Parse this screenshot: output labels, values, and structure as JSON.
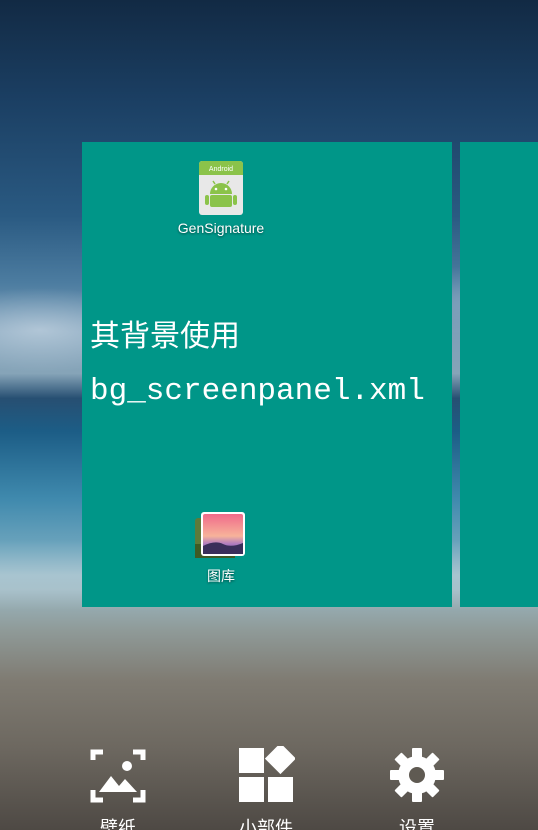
{
  "home": {
    "apps": [
      {
        "label": "GenSignature",
        "icon": "android-app-icon"
      },
      {
        "label": "图库",
        "icon": "gallery-icon"
      }
    ],
    "caption_line1": "其背景使用",
    "caption_line2": "bg_screenpanel.xml",
    "android_badge_text": "Android"
  },
  "bottom_bar": {
    "wallpaper_label": "壁纸",
    "widgets_label": "小部件",
    "settings_label": "设置"
  },
  "colors": {
    "panel": "#009688",
    "icon_white": "#ffffff",
    "android_green": "#a4c639"
  }
}
